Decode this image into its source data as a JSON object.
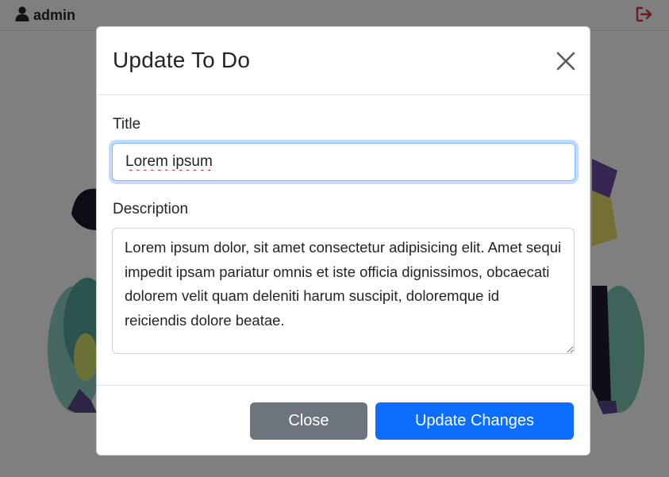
{
  "navbar": {
    "username": "admin",
    "user_icon": "user-icon",
    "logout_icon": "logout-icon"
  },
  "modal": {
    "title": "Update To Do",
    "close_icon": "close-icon",
    "title_label": "Title",
    "title_value": "Lorem ipsum",
    "description_label": "Description",
    "description_value": "Lorem ipsum dolor, sit amet consectetur adipisicing elit. Amet sequi impedit ipsam pariatur omnis et iste officia dignissimos, obcaecati dolorem velit quam deleniti harum suscipit, doloremque id reiciendis dolore beatae.",
    "close_button": "Close",
    "update_button": "Update Changes"
  },
  "colors": {
    "primary": "#0d6efd",
    "secondary": "#6c757d",
    "logout": "#dc3545"
  }
}
